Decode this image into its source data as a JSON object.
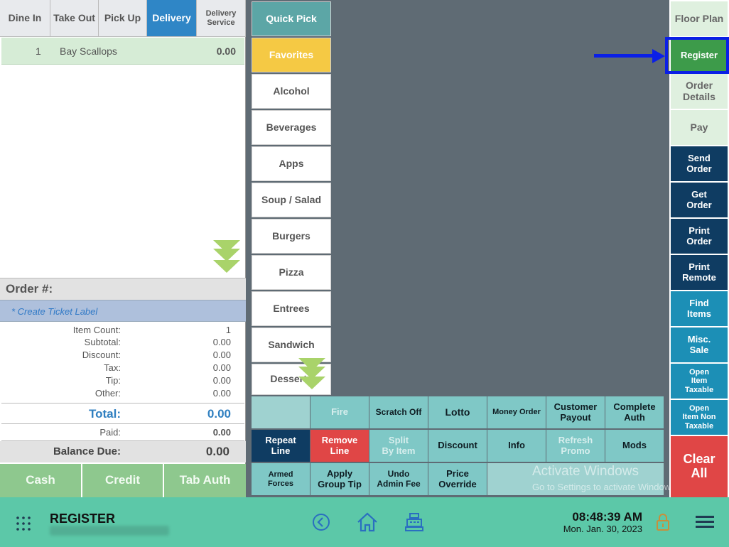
{
  "order_types": {
    "dine_in": "Dine In",
    "take_out": "Take Out",
    "pick_up": "Pick Up",
    "delivery": "Delivery",
    "delivery_service_1": "Delivery",
    "delivery_service_2": "Service",
    "active": "Delivery"
  },
  "order_items": [
    {
      "qty": "1",
      "name": "Bay Scallops",
      "price": "0.00"
    }
  ],
  "order_number_label": "Order #:",
  "ticket_label": "* Create Ticket Label",
  "totals": {
    "item_count_label": "Item Count:",
    "item_count": "1",
    "subtotal_label": "Subtotal:",
    "subtotal": "0.00",
    "discount_label": "Discount:",
    "discount": "0.00",
    "tax_label": "Tax:",
    "tax": "0.00",
    "tip_label": "Tip:",
    "tip": "0.00",
    "other_label": "Other:",
    "other": "0.00",
    "total_label": "Total:",
    "total": "0.00",
    "paid_label": "Paid:",
    "paid": "0.00",
    "balance_label": "Balance Due:",
    "balance": "0.00"
  },
  "payment_buttons": {
    "cash": "Cash",
    "credit": "Credit",
    "tab_auth": "Tab Auth"
  },
  "categories": {
    "quick_pick": "Quick Pick",
    "favorites": "Favorites",
    "alcohol": "Alcohol",
    "beverages": "Beverages",
    "apps": "Apps",
    "soup_salad": "Soup / Salad",
    "burgers": "Burgers",
    "pizza": "Pizza",
    "entrees": "Entrees",
    "sandwich": "Sandwich",
    "desserts": "Desserts"
  },
  "functions": {
    "fire": "Fire",
    "scratch_off": "Scratch Off",
    "lotto": "Lotto",
    "money_order": "Money Order",
    "customer_payout_1": "Customer",
    "customer_payout_2": "Payout",
    "complete_auth_1": "Complete",
    "complete_auth_2": "Auth",
    "repeat_line_1": "Repeat",
    "repeat_line_2": "Line",
    "remove_line_1": "Remove",
    "remove_line_2": "Line",
    "split_by_item_1": "Split",
    "split_by_item_2": "By Item",
    "discount": "Discount",
    "info": "Info",
    "refresh_promo_1": "Refresh",
    "refresh_promo_2": "Promo",
    "mods": "Mods",
    "armed_forces_1": "Armed",
    "armed_forces_2": "Forces",
    "apply_group_tip_1": "Apply",
    "apply_group_tip_2": "Group Tip",
    "undo_admin_fee_1": "Undo",
    "undo_admin_fee_2": "Admin Fee",
    "price_override_1": "Price",
    "price_override_2": "Override"
  },
  "right_nav": {
    "floor_plan": "Floor Plan",
    "register": "Register",
    "order_details_1": "Order",
    "order_details_2": "Details",
    "pay": "Pay",
    "send_order_1": "Send",
    "send_order_2": "Order",
    "get_order_1": "Get",
    "get_order_2": "Order",
    "print_order_1": "Print",
    "print_order_2": "Order",
    "print_remote_1": "Print",
    "print_remote_2": "Remote",
    "find_items_1": "Find",
    "find_items_2": "Items",
    "misc_sale_1": "Misc.",
    "misc_sale_2": "Sale",
    "open_item_taxable_1": "Open",
    "open_item_taxable_2": "Item",
    "open_item_taxable_3": "Taxable",
    "open_item_non_taxable_1": "Open",
    "open_item_non_taxable_2": "Item Non",
    "open_item_non_taxable_3": "Taxable",
    "clear_all_1": "Clear",
    "clear_all_2": "All"
  },
  "watermark": {
    "title": "Activate Windows",
    "subtitle": "Go to Settings to activate Windows."
  },
  "bottom_bar": {
    "screen_name": "REGISTER",
    "time": "08:48:39 AM",
    "date": "Mon. Jan. 30, 2023"
  },
  "colors": {
    "active_tab": "#2f86c6",
    "register_button": "#3d9b4a",
    "highlight_arrow": "#0a1fe6",
    "bottom_bar": "#5cc8a8",
    "clear_all": "#e04646",
    "navy_button": "#0f3c62",
    "teal_button": "#1c8fb6"
  },
  "icons": [
    "apps-grid-icon",
    "back-arrow-icon",
    "home-icon",
    "cash-register-icon",
    "lock-icon",
    "hamburger-menu-icon",
    "scroll-down-icon"
  ]
}
